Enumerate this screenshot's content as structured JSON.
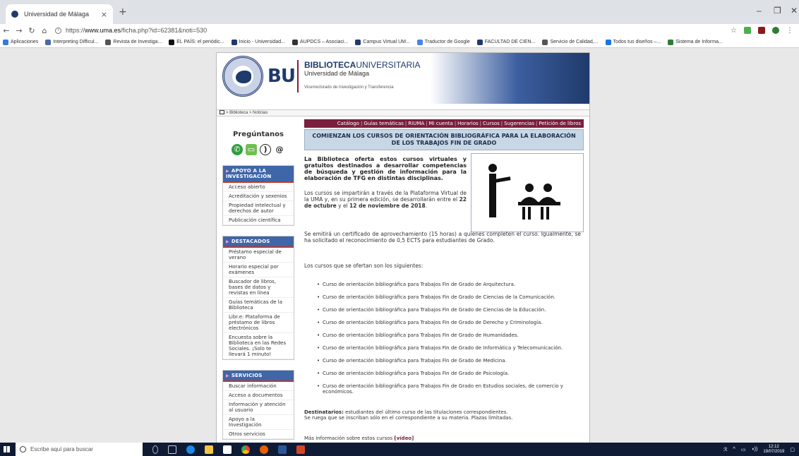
{
  "browser": {
    "tab_title": "Universidad de Málaga",
    "tab_close": "×",
    "new_tab": "+",
    "url_prefix": "https://",
    "url_host": "www.uma.es",
    "url_path": "/ficha.php?id=62381&noti=530",
    "bookmarks": [
      {
        "label": "Aplicaciones",
        "color": "#3c78d8"
      },
      {
        "label": "Interpreting Difficul...",
        "color": "#4a6aa5"
      },
      {
        "label": "Revista de Investiga...",
        "color": "#555555"
      },
      {
        "label": "EL PAÍS: el periódic...",
        "color": "#111111"
      },
      {
        "label": "Inicio - Universidad...",
        "color": "#1f3a6b"
      },
      {
        "label": "AUPDCS – Asociaci...",
        "color": "#333333"
      },
      {
        "label": "Campus Virtual UM...",
        "color": "#1f3a6b"
      },
      {
        "label": "Traductor de Google",
        "color": "#4285f4"
      },
      {
        "label": "FACULTAD DE CIEN...",
        "color": "#1f3a6b"
      },
      {
        "label": "Servicio de Calidad,...",
        "color": "#555555"
      },
      {
        "label": "Todos tus diseños –...",
        "color": "#1a73e8"
      },
      {
        "label": "Sistema de Informa...",
        "color": "#2e7d32"
      }
    ]
  },
  "site": {
    "bu_logo": "BU",
    "biblio_bold": "BIBLIOTECA",
    "biblio_rest": "UNIVERSITARIA",
    "university": "Universidad de Málaga",
    "vicerrectorado": "Vicerrectorado de Investigación y Transferencia",
    "breadcrumb": "> Biblioteca > Noticias"
  },
  "sidebar": {
    "ask_title": "Pregúntanos",
    "sections": [
      {
        "title": "APOYO A LA INVESTIGACIÓN",
        "items": [
          "Acceso abierto",
          "Acreditación y sexenios",
          "Propiedad intelectual y derechos de autor",
          "Publicación científica"
        ]
      },
      {
        "title": "DESTACADOS",
        "items": [
          "Préstamo especial de verano",
          "Horario especial por exámenes",
          "Buscador de libros, bases de datos y revistas en línea",
          "Guías temáticas de la Biblioteca",
          "Libr.e: Plataforma de préstamo de libros electrónicos",
          "Encuesta sobre la Biblioteca en las Redes Sociales. ¡Solo te llevará 1 minuto!"
        ]
      },
      {
        "title": "SERVICIOS",
        "items": [
          "Buscar información",
          "Acceso a documentos",
          "Información y atención al usuario",
          "Apoyo a la Investigación",
          "Otros servicios"
        ]
      }
    ]
  },
  "main": {
    "nav": [
      "Catálogo",
      "Guías temáticas",
      "RIUMA",
      "Mi cuenta",
      "Horarios",
      "Cursos",
      "Sugerencias",
      "Petición de libros"
    ],
    "title": "COMIENZAN LOS CURSOS DE ORIENTACIÓN BIBLIOGRÁFICA PARA LA ELABORACIÓN DE LOS TRABAJOS FIN DE GRADO",
    "intro": "La Biblioteca oferta estos cursos virtuales y gratuitos destinados a desarrollar competencias de búsqueda y gestión de información para la elaboración de TFG en distintas disciplinas.",
    "p2_a": "Los cursos se impartirán a través de la Plataforma Virtual de la UMA y, en su primera edición, se desarrollarán entre el ",
    "p2_date1": "22 de octubre",
    "p2_b": " y el ",
    "p2_date2": "12 de noviembre de 2018",
    "p2_c": ".",
    "p3": "Se emitirá un certificado de aprovechamiento (15 horas) a quienes completen el curso. Igualmente, se ha solicitado el reconocimiento de 0,5 ECTS para estudiantes de Grado.",
    "p4": "Los cursos que se ofertan son los siguientes:",
    "courses": [
      "Curso de orientación bibliográfica para Trabajos Fin de Grado de Arquitectura.",
      "Curso de orientación bibliográfica para Trabajos Fin de Grado de Ciencias de la Comunicación.",
      "Curso de orientación bibliográfica para Trabajos Fin de Grado de Ciencias de la Educación.",
      "Curso de orientación bibliográfica para Trabajos Fin de Grado de Derecho y Criminología.",
      "Curso de orientación bibliográfica para Trabajos Fin de Grado de Humanidades.",
      "Curso de orientación bibliográfica para Trabajos Fin de Grado de Informática y Telecomunicación.",
      "Curso de orientación bibliográfica para Trabajos Fin de Grado de Medicina.",
      "Curso de orientación bibliográfica para Trabajos Fin de Grado de Psicología.",
      "Curso de orientación bibliográfica para Trabajos Fin de Grado en Estudios sociales, de comercio y económicos."
    ],
    "dest_label": "Destinatarios:",
    "dest_text": " estudiantes del último curso de las titulaciones correspondientes.",
    "dest_text2": "Se ruega que se inscriban sólo en el correspondiente a su materia. Plazas limitadas.",
    "more_text": "Más información sobre estos cursos ",
    "more_link": "[vídeo]"
  },
  "taskbar": {
    "search_placeholder": "Escribe aquí para buscar",
    "time": "12:12",
    "date": "19/07/2019"
  },
  "colors": {
    "brand_blue": "#1f3a6b",
    "nav_maroon": "#7a1f3d",
    "menu_head": "#3f66a8"
  }
}
